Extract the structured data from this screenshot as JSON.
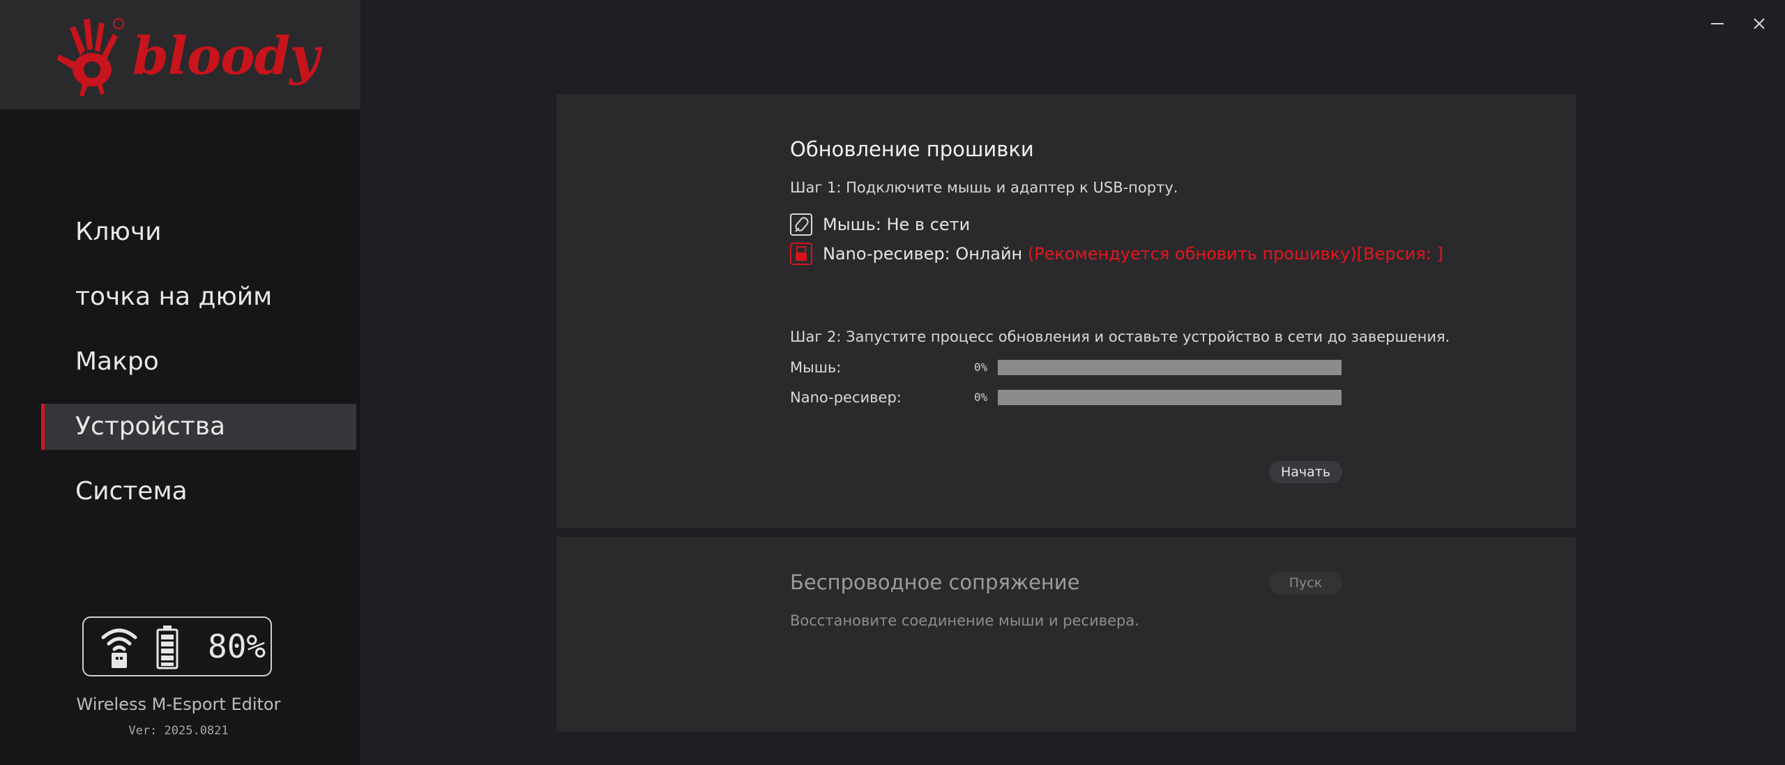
{
  "window": {
    "minimize_icon": "minimize-icon",
    "close_icon": "close-icon"
  },
  "brand": {
    "logo_text": "bloody",
    "accent_color": "#d3141c"
  },
  "sidebar": {
    "items": [
      {
        "label": "Ключи",
        "active": false
      },
      {
        "label": "точка на дюйм",
        "active": false
      },
      {
        "label": "Макро",
        "active": false
      },
      {
        "label": "Устройства",
        "active": true
      },
      {
        "label": "Система",
        "active": false
      }
    ],
    "status": {
      "wifi_icon": "wifi-receiver-icon",
      "battery_icon": "battery-icon",
      "battery_percent": "80%",
      "battery_level": 0.8
    },
    "app_name": "Wireless M-Esport Editor",
    "version": "Ver: 2025.0821"
  },
  "firmware": {
    "title": "Обновление прошивки",
    "step1": "Шаг 1: Подключите мышь и адаптер к USB-порту.",
    "mouse_status": "Мышь: Не в сети",
    "nano_status": "Nano-ресивер: Онлайн",
    "nano_warning": "(Рекомендуется обновить прошивку)[Версия: ]",
    "step2": "Шаг 2: Запустите процесс обновления и оставьте устройство в сети до завершения.",
    "progress": [
      {
        "label": "Мышь:",
        "percent_text": "0%",
        "value": 0
      },
      {
        "label": "Nano-ресивер:",
        "percent_text": "0%",
        "value": 0
      }
    ],
    "start_button": "Начать"
  },
  "pairing": {
    "title": "Беспроводное сопряжение",
    "description": "Восстановите соединение  мыши и ресивера.",
    "go_button": "Пуск"
  }
}
